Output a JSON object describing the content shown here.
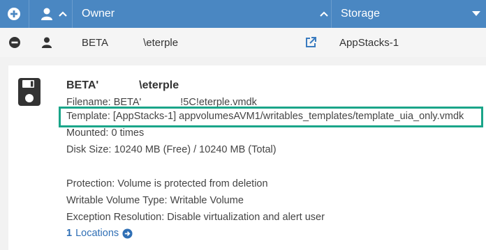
{
  "header": {
    "owner_label": "Owner",
    "storage_label": "Storage",
    "icons": [
      "plus-circle-icon",
      "user-icon",
      "chevron-up-icon",
      "sort-up-icon",
      "dropdown-caret-icon"
    ]
  },
  "row": {
    "owner_prefix": "BETA",
    "owner_suffix": "\\eterple",
    "storage": "AppStacks-1",
    "icons": [
      "minus-circle-icon",
      "user-icon",
      "external-link-icon"
    ]
  },
  "details": {
    "title_prefix": "BETA'",
    "title_suffix": "\\eterple",
    "filename_prefix": "Filename: BETA'",
    "filename_suffix": "!5C!eterple.vmdk",
    "template": "Template: [AppStacks-1] appvolumesAVM1/writables_templates/template_uia_only.vmdk",
    "mounted": "Mounted: 0 times",
    "disk_size": "Disk Size: 10240 MB (Free) / 10240 MB (Total)",
    "protection": "Protection: Volume is protected from deletion",
    "writable_type": "Writable Volume Type: Writable Volume",
    "exception": "Exception Resolution: Disable virtualization and alert user",
    "locations_count": "1",
    "locations_label": "Locations",
    "icons": [
      "floppy-disk-icon",
      "arrow-circle-right-icon"
    ]
  },
  "colors": {
    "header_bg": "#4a87c2",
    "highlight_border": "#1aa589",
    "link": "#2f6fb5"
  }
}
